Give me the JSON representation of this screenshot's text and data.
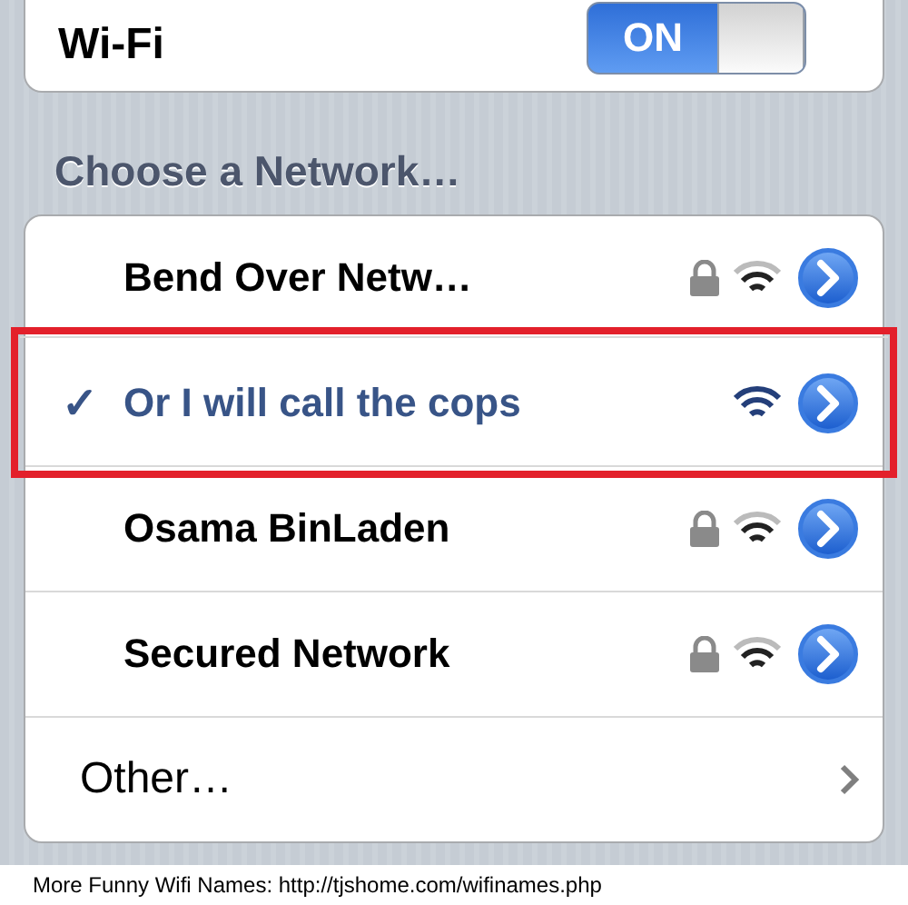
{
  "wifi": {
    "label": "Wi-Fi",
    "on": true,
    "toggle_text": "ON"
  },
  "section_title": "Choose a Network…",
  "check_mark": "✓",
  "networks": [
    {
      "name": "Bend Over Netw…",
      "selected": false,
      "secured": true,
      "highlighted": false
    },
    {
      "name": "Or I will call the cops",
      "selected": true,
      "secured": false,
      "highlighted": true
    },
    {
      "name": "Osama BinLaden",
      "selected": false,
      "secured": true,
      "highlighted": false
    },
    {
      "name": "Secured Network",
      "selected": false,
      "secured": true,
      "highlighted": false
    }
  ],
  "other": {
    "label": "Other…"
  },
  "caption": "More Funny Wifi Names: http://tjshome.com/wifinames.php"
}
